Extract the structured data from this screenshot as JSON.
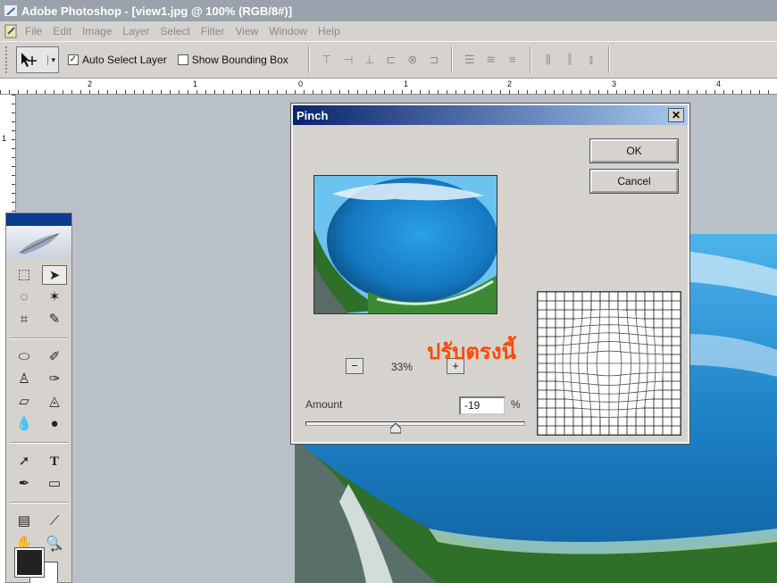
{
  "window": {
    "title": "Adobe Photoshop - [view1.jpg @ 100% (RGB/8#)]"
  },
  "menu": {
    "items": [
      "File",
      "Edit",
      "Image",
      "Layer",
      "Select",
      "Filter",
      "View",
      "Window",
      "Help"
    ]
  },
  "options": {
    "auto_select_label": "Auto Select Layer",
    "auto_select_checked": true,
    "bounding_box_label": "Show Bounding Box",
    "bounding_box_checked": false
  },
  "ruler": {
    "h_numbers": [
      "2",
      "1",
      "0",
      "1",
      "2",
      "3",
      "4"
    ],
    "v_numbers": [
      "1"
    ]
  },
  "dialog": {
    "title": "Pinch",
    "ok_label": "OK",
    "cancel_label": "Cancel",
    "zoom_value": "33%",
    "zoom_out_label": "−",
    "zoom_in_label": "+",
    "amount_label": "Amount",
    "amount_value": "-19",
    "amount_unit": "%",
    "annotation": "ปรับตรงนี้"
  },
  "colors": {
    "annotation": "#ff4a00",
    "title_bar": "#0a246a",
    "foreground": "#222222",
    "background": "#ffffff"
  }
}
